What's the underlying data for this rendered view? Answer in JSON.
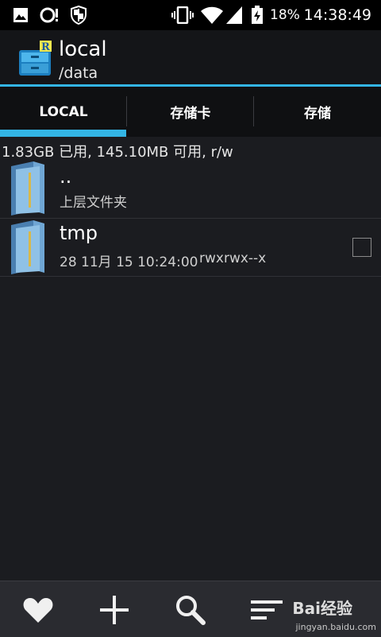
{
  "status_bar": {
    "battery_percent": "18%",
    "time": "14:38:49",
    "icons": [
      "image-icon",
      "sync-alert-icon",
      "shield-icon",
      "vibrate-icon",
      "wifi-icon",
      "signal-icon",
      "battery-icon"
    ]
  },
  "app_bar": {
    "title": "local",
    "path": "/data",
    "app_icon": "root-explorer-icon",
    "accent_color": "#33b5e5"
  },
  "tabs": [
    {
      "label": "LOCAL",
      "selected": true
    },
    {
      "label": "存储卡",
      "selected": false
    },
    {
      "label": "存储",
      "selected": false
    }
  ],
  "storage_info": "1.83GB 已用, 145.10MB 可用, r/w",
  "list": [
    {
      "name": "..",
      "sub": "上层文件夹",
      "icon": "folder-icon",
      "checkbox": false
    },
    {
      "name": "tmp",
      "date": "28 11月 15 10:24:00",
      "perms": "rwxrwx--x",
      "icon": "folder-icon",
      "checkbox": true,
      "checked": false
    }
  ],
  "bottom_bar": {
    "buttons": [
      "favorite-icon",
      "add-icon",
      "search-icon",
      "sort-icon"
    ],
    "watermark_logo": "Bai经验",
    "watermark_url": "jingyan.baidu.com"
  }
}
